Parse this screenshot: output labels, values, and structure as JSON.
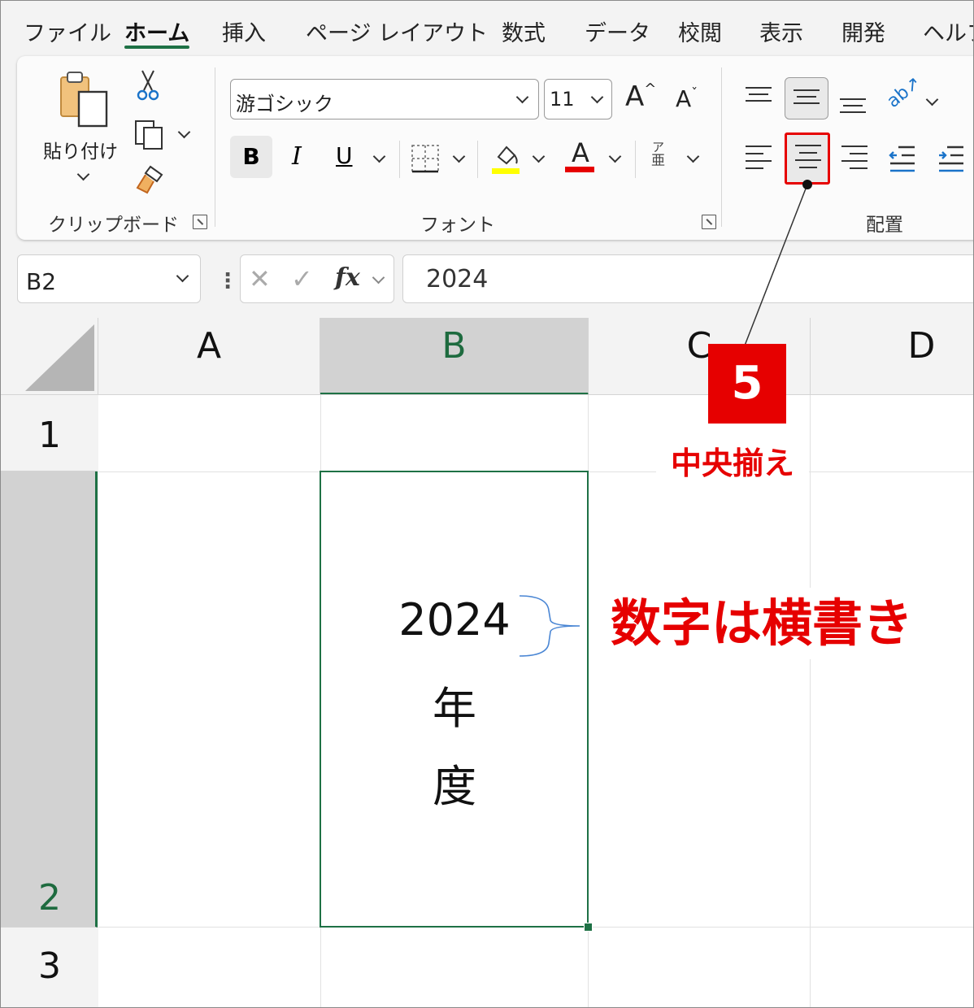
{
  "menu": {
    "tabs": [
      "ファイル",
      "ホーム",
      "挿入",
      "ページ レイアウト",
      "数式",
      "データ",
      "校閲",
      "表示",
      "開発",
      "ヘルプ"
    ],
    "active_tab": "ホーム"
  },
  "ribbon": {
    "clipboard": {
      "paste_label": "貼り付け",
      "group_label": "クリップボード"
    },
    "font": {
      "font_name": "游ゴシック",
      "font_size": "11",
      "bold": "B",
      "italic": "I",
      "underline": "U",
      "font_color_glyph": "A",
      "phonetic_top": "ア",
      "phonetic_bottom": "亜",
      "group_label": "フォント",
      "fill_color": "#ffff00",
      "font_color": "#ff0000"
    },
    "alignment": {
      "group_label": "配置"
    }
  },
  "formula_bar": {
    "name_box": "B2",
    "fx": "fx",
    "value": "2024"
  },
  "sheet": {
    "columns": [
      "A",
      "B",
      "C",
      "D"
    ],
    "rows": [
      "1",
      "2",
      "3"
    ],
    "selected_cell": "B2",
    "cell_b2_lines": [
      "2024",
      "年",
      "度"
    ]
  },
  "annotations": {
    "step_number": "5",
    "step_label": "中央揃え",
    "note": "数字は横書き",
    "accent_color": "#e60000"
  }
}
